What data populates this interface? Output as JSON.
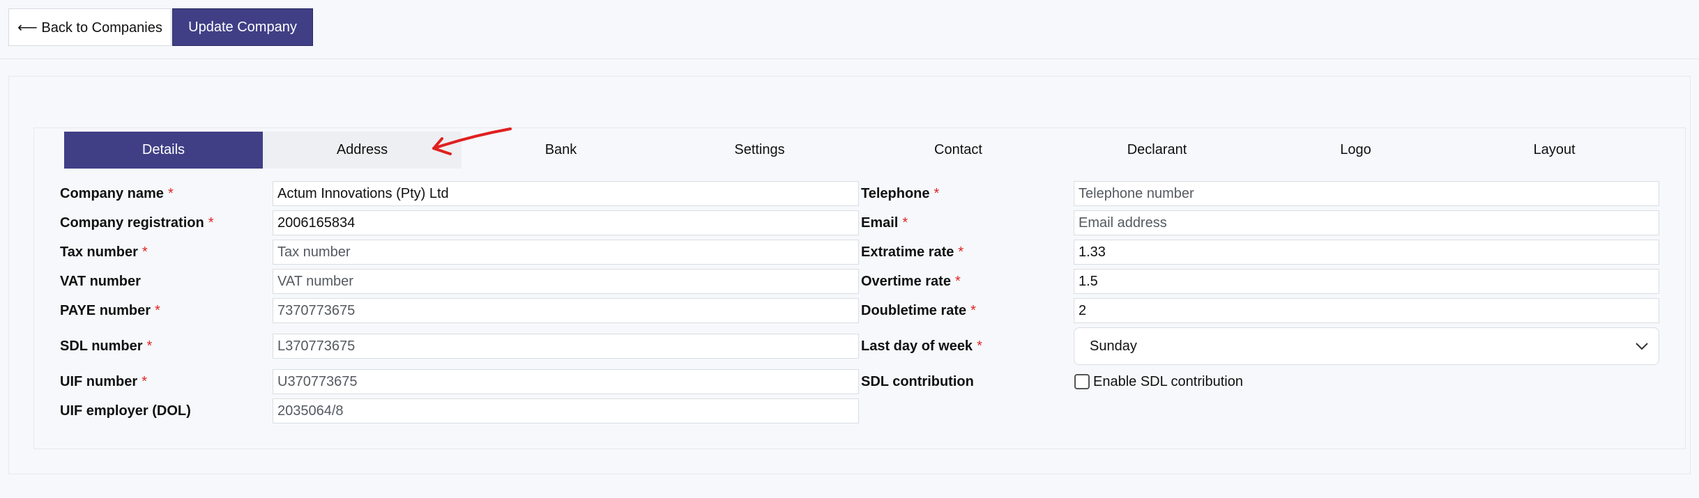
{
  "toolbar": {
    "back_label": "⟵ Back to Companies",
    "update_label": "Update Company"
  },
  "tabs": [
    {
      "label": "Details",
      "active": true
    },
    {
      "label": "Address"
    },
    {
      "label": "Bank"
    },
    {
      "label": "Settings"
    },
    {
      "label": "Contact"
    },
    {
      "label": "Declarant"
    },
    {
      "label": "Logo"
    },
    {
      "label": "Layout"
    }
  ],
  "left_fields": [
    {
      "label": "Company name",
      "required": "*",
      "value": "Actum Innovations (Pty) Ltd"
    },
    {
      "label": "Company registration",
      "required": "*",
      "value": "2006165834"
    },
    {
      "label": "Tax number",
      "required": "*",
      "placeholder": "Tax number"
    },
    {
      "label": "VAT number",
      "required": "",
      "placeholder": "VAT number"
    },
    {
      "label": "PAYE number",
      "required": "*",
      "value": "7370773675"
    },
    {
      "label": "SDL number",
      "required": "*",
      "value": "L370773675"
    },
    {
      "label": "UIF number",
      "required": "*",
      "value": "U370773675"
    },
    {
      "label": "UIF employer (DOL)",
      "required": "",
      "value": "2035064/8"
    }
  ],
  "right_fields": [
    {
      "label": "Telephone",
      "required": "*",
      "placeholder": "Telephone number"
    },
    {
      "label": "Email",
      "required": "*",
      "placeholder": "Email address"
    },
    {
      "label": "Extratime rate",
      "required": "*",
      "value": "1.33"
    },
    {
      "label": "Overtime rate",
      "required": "*",
      "value": "1.5"
    },
    {
      "label": "Doubletime rate",
      "required": "*",
      "value": "2"
    },
    {
      "label": "Last day of week",
      "required": "*",
      "value": "Sunday"
    },
    {
      "label": "SDL contribution",
      "required": "",
      "checkbox_label": "Enable SDL contribution",
      "checked": false
    }
  ],
  "colors": {
    "primary": "#403f86",
    "required": "#e02424",
    "annotation": "#e02020"
  }
}
